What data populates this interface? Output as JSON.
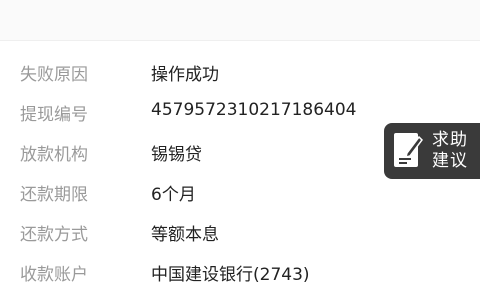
{
  "details": [
    {
      "label": "失败原因",
      "value": "操作成功"
    },
    {
      "label": "提现编号",
      "value": "4579572310217186404"
    },
    {
      "label": "放款机构",
      "value": "锡锡贷"
    },
    {
      "label": "还款期限",
      "value": "6个月"
    },
    {
      "label": "还款方式",
      "value": "等额本息"
    },
    {
      "label": "收款账户",
      "value": "中国建设银行(2743)"
    }
  ],
  "help_button": {
    "line1": "求助",
    "line2": "建议",
    "icon": "edit-note-icon",
    "background": "#3a3a3a"
  }
}
